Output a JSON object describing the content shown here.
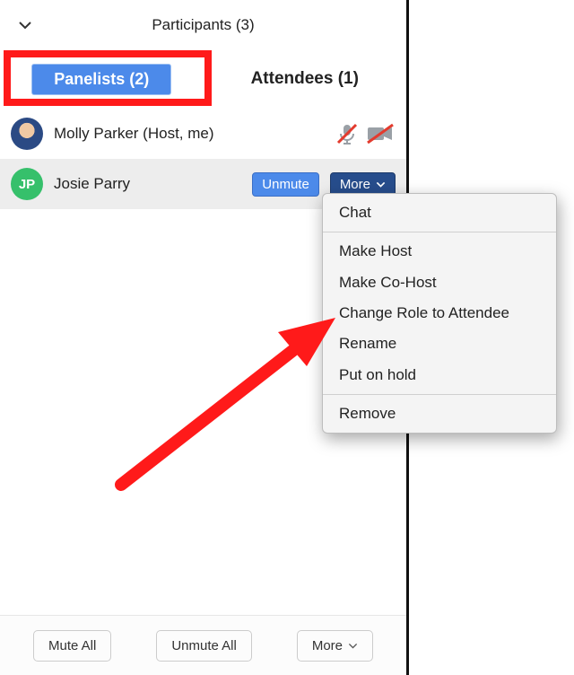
{
  "header": {
    "title": "Participants (3)"
  },
  "tabs": {
    "panelists": "Panelists (2)",
    "attendees": "Attendees (1)"
  },
  "participants": {
    "p0": {
      "name": "Molly Parker (Host, me)",
      "initials": ""
    },
    "p1": {
      "name": "Josie Parry",
      "initials": "JP",
      "unmute_label": "Unmute",
      "more_label": "More"
    }
  },
  "menu": {
    "chat": "Chat",
    "make_host": "Make Host",
    "make_cohost": "Make Co-Host",
    "change_role": "Change Role to Attendee",
    "rename": "Rename",
    "put_on_hold": "Put on hold",
    "remove": "Remove"
  },
  "footer": {
    "mute_all": "Mute All",
    "unmute_all": "Unmute All",
    "more": "More"
  },
  "colors": {
    "accent_blue": "#4c8aea",
    "dark_blue": "#274d8c",
    "green": "#36c06b",
    "highlight_red": "#ff1a1a"
  }
}
